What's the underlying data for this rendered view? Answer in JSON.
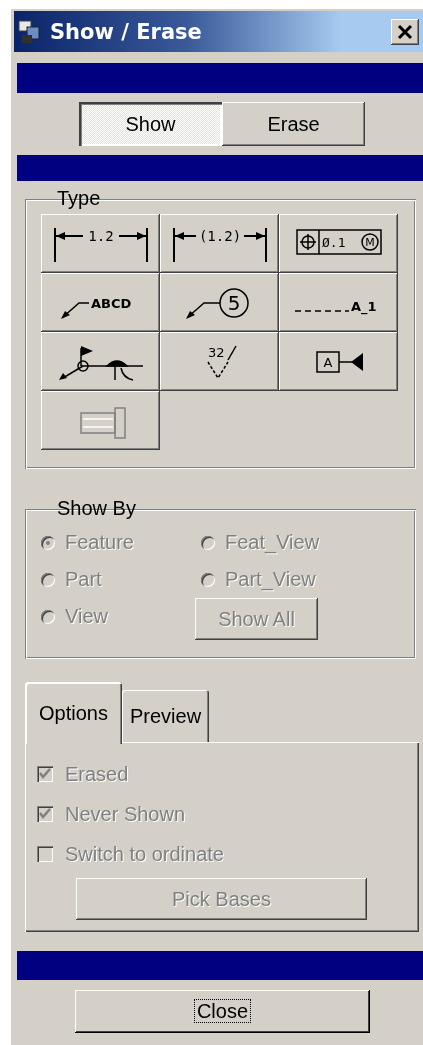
{
  "window": {
    "title": "Show / Erase"
  },
  "mode_buttons": [
    {
      "label": "Show",
      "selected": true
    },
    {
      "label": "Erase",
      "selected": false
    }
  ],
  "type_group": {
    "title": "Type",
    "buttons": [
      {
        "kind": "dimension",
        "labels": [
          "1.2"
        ]
      },
      {
        "kind": "ref_dimension",
        "labels": [
          "(1.2)"
        ]
      },
      {
        "kind": "geom_tol",
        "labels": [
          "Ø.1",
          "M"
        ]
      },
      {
        "kind": "note",
        "labels": [
          "ABCD"
        ]
      },
      {
        "kind": "balloon",
        "labels": [
          "5"
        ]
      },
      {
        "kind": "axis",
        "labels": [
          "A_1"
        ]
      },
      {
        "kind": "weld"
      },
      {
        "kind": "surface_finish",
        "labels": [
          "32"
        ]
      },
      {
        "kind": "datum",
        "labels": [
          "A"
        ]
      },
      {
        "kind": "cosmetic"
      }
    ]
  },
  "show_by": {
    "title": "Show By",
    "options": [
      {
        "label": "Feature",
        "selected": true,
        "disabled": true
      },
      {
        "label": "Feat_View",
        "selected": false,
        "disabled": true
      },
      {
        "label": "Part",
        "selected": false,
        "disabled": true
      },
      {
        "label": "Part_View",
        "selected": false,
        "disabled": true
      },
      {
        "label": "View",
        "selected": false,
        "disabled": true
      }
    ],
    "show_all": {
      "label": "Show All",
      "disabled": true
    }
  },
  "tabs": [
    {
      "label": "Options",
      "selected": true
    },
    {
      "label": "Preview",
      "selected": false
    }
  ],
  "options": {
    "checkboxes": [
      {
        "label": "Erased",
        "checked": true,
        "disabled": true
      },
      {
        "label": "Never Shown",
        "checked": true,
        "disabled": true
      },
      {
        "label": "Switch to ordinate",
        "checked": false,
        "disabled": true
      }
    ],
    "pick_bases": {
      "label": "Pick Bases",
      "disabled": true
    }
  },
  "close_button": {
    "label": "Close",
    "focused": true
  }
}
